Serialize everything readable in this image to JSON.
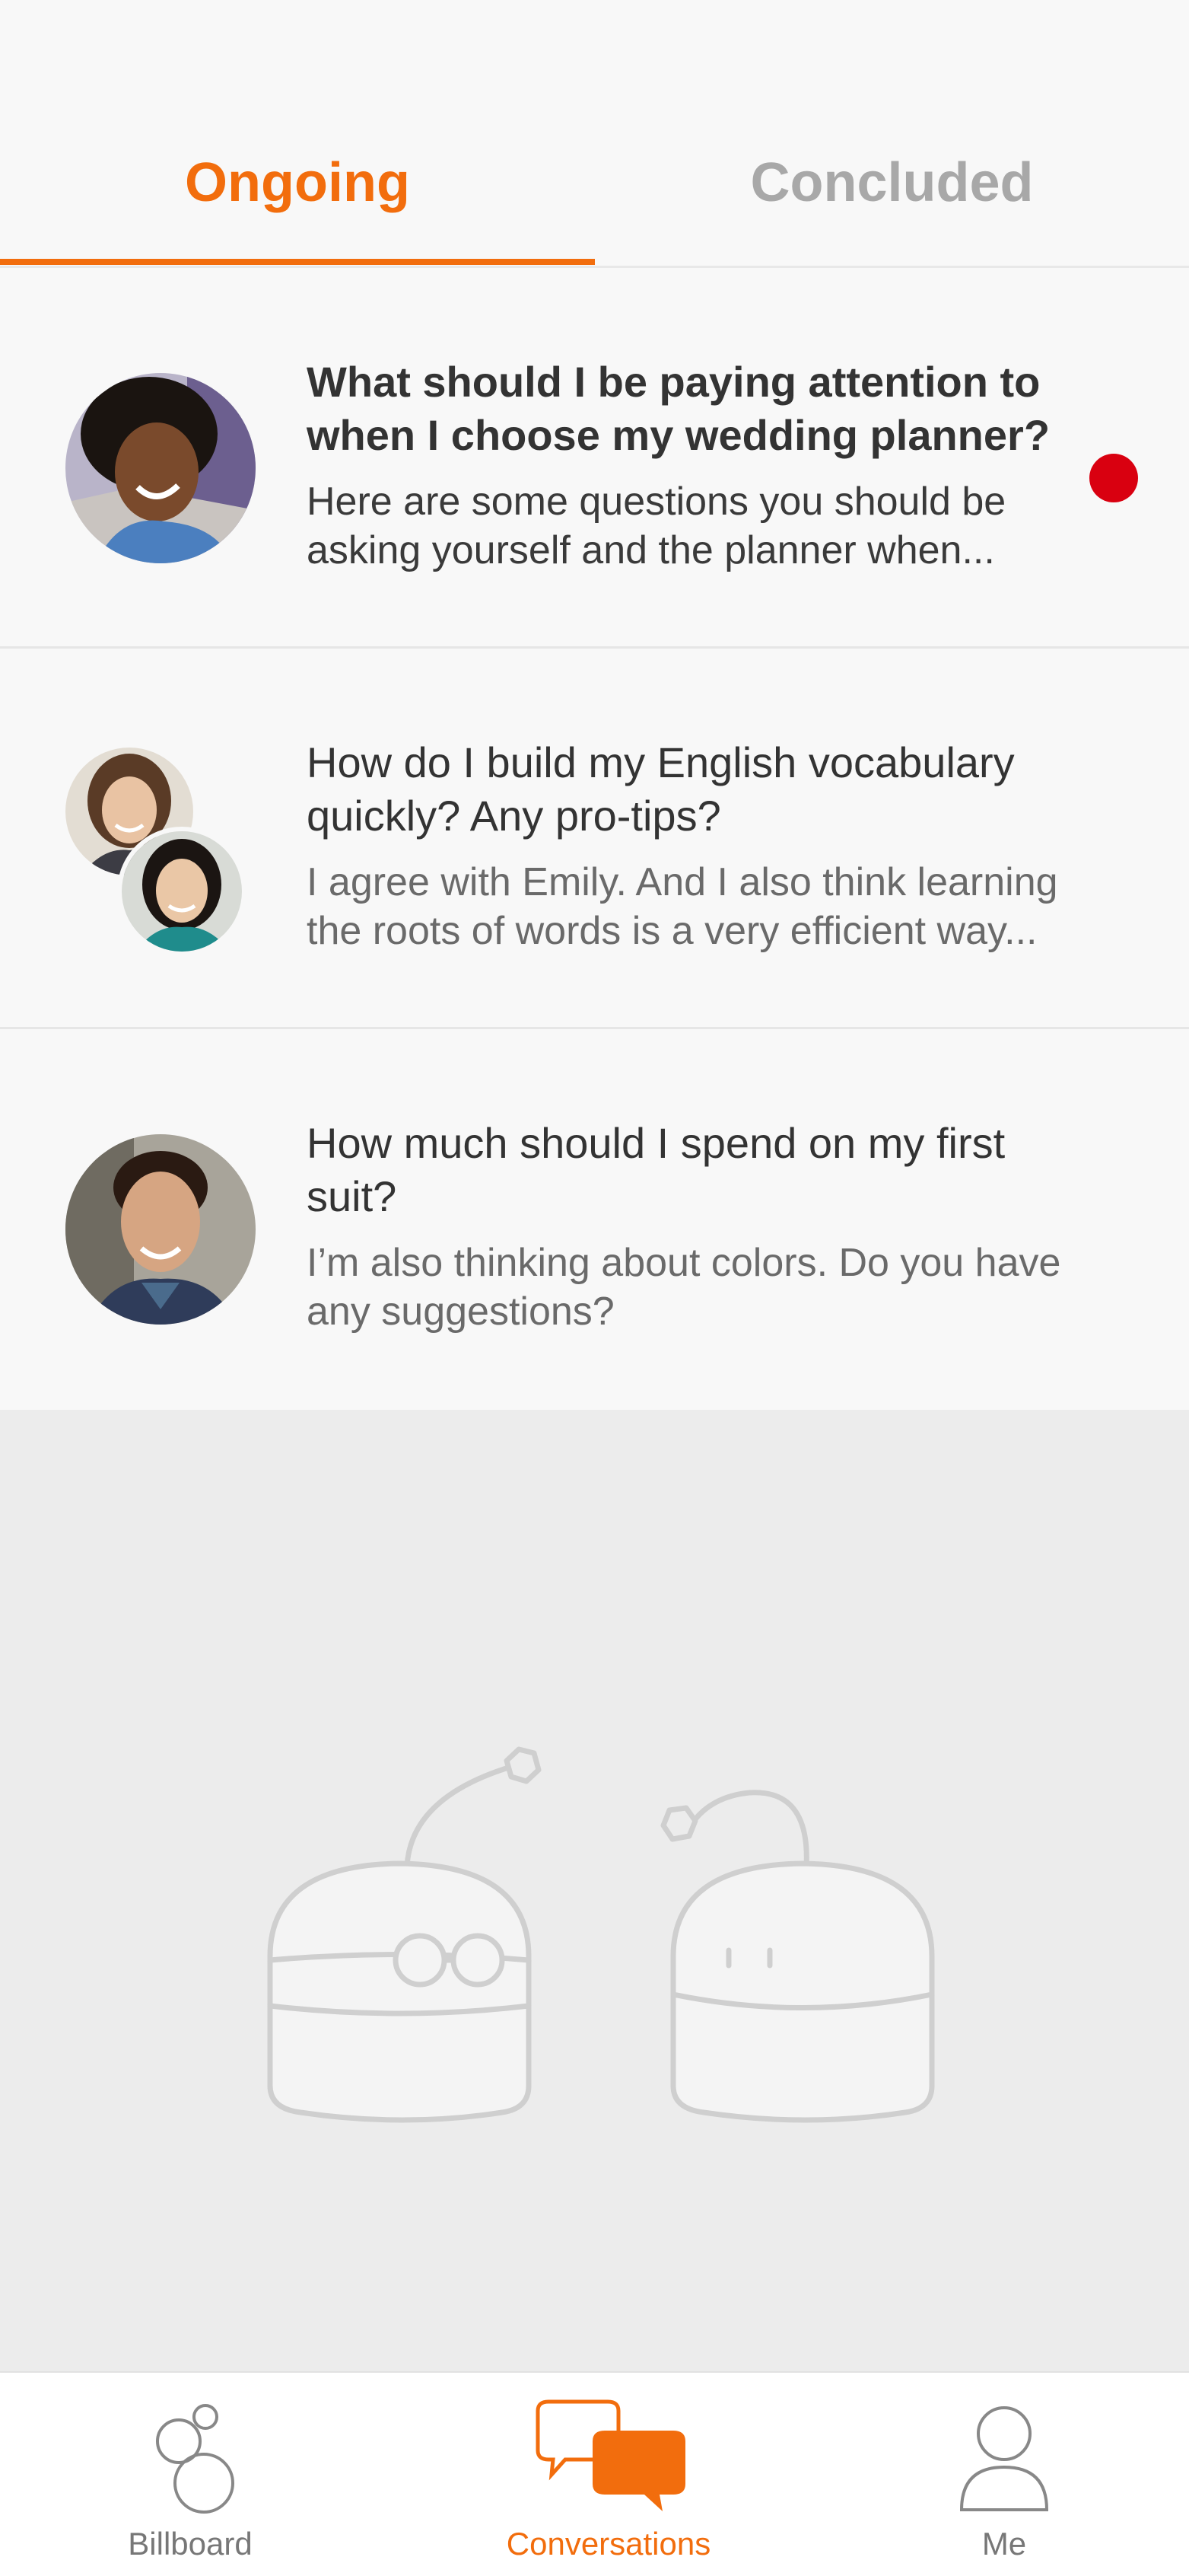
{
  "tabs": {
    "ongoing": "Ongoing",
    "concluded": "Concluded",
    "active": "ongoing"
  },
  "conversations": [
    {
      "title": "What should I be paying attention to when I choose my wedding planner?",
      "preview": "Here are some questions you should be asking yourself and the planner when...",
      "unread": true
    },
    {
      "title": "How do I build my English vocabulary quickly? Any pro-tips?",
      "preview": "I agree with Emily. And I also think learning the roots of words is a very efficient way...",
      "unread": false
    },
    {
      "title": "How much should I spend on my first suit?",
      "preview": "I’m also thinking about colors. Do you have any suggestions?",
      "unread": false
    }
  ],
  "nav": {
    "billboard": "Billboard",
    "conversations": "Conversations",
    "me": "Me",
    "active": "conversations"
  },
  "colors": {
    "accent": "#f26d0d",
    "unread_dot": "#d90010",
    "tab_inactive": "#a8a8a8"
  }
}
